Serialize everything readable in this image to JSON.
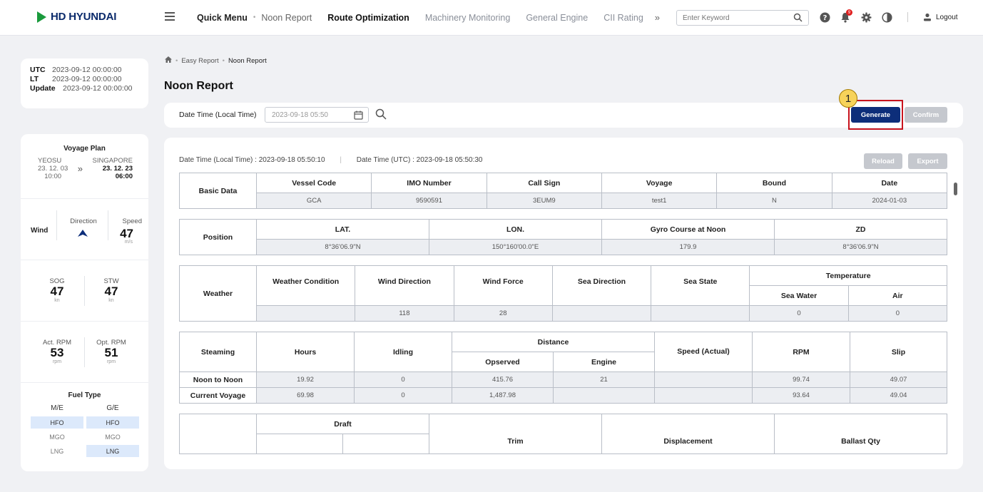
{
  "brand": {
    "name": "HD HYUNDAI"
  },
  "nav": {
    "quick_menu": "Quick Menu",
    "noon_report": "Noon Report",
    "items": [
      "Route Optimization",
      "Machinery Monitoring",
      "General Engine",
      "CII Rating"
    ],
    "more": "»"
  },
  "search": {
    "placeholder": "Enter Keyword"
  },
  "header": {
    "notification_count": "9",
    "logout": "Logout"
  },
  "time": {
    "utc_label": "UTC",
    "utc": "2023-09-12 00:00:00",
    "lt_label": "LT",
    "lt": "2023-09-12 00:00:00",
    "update_label": "Update",
    "update": "2023-09-12 00:00:00"
  },
  "voyage": {
    "title": "Voyage Plan",
    "from": "YEOSU",
    "to": "SINGAPORE",
    "from_date": "23. 12. 03",
    "from_time": "10:00",
    "to_date": "23. 12. 23",
    "to_time": "06:00",
    "arrow": "»"
  },
  "wind": {
    "label": "Wind",
    "direction_label": "Direction",
    "speed_label": "Speed",
    "speed": "47",
    "speed_unit": "m/s"
  },
  "speed": {
    "sog_label": "SOG",
    "sog": "47",
    "sog_unit": "kn",
    "stw_label": "STW",
    "stw": "47",
    "stw_unit": "kn"
  },
  "rpm": {
    "act_label": "Act. RPM",
    "act": "53",
    "act_unit": "rpm",
    "opt_label": "Opt. RPM",
    "opt": "51",
    "opt_unit": "rpm"
  },
  "fuel": {
    "title": "Fuel Type",
    "me": "M/E",
    "ge": "G/E",
    "me_items": [
      "HFO",
      "MGO",
      "LNG"
    ],
    "ge_items": [
      "HFO",
      "MGO",
      "LNG"
    ]
  },
  "breadcrumb": {
    "items": [
      "Easy Report",
      "Noon Report"
    ]
  },
  "page": {
    "title": "Noon Report"
  },
  "filter": {
    "label": "Date Time (Local Time)",
    "date": "2023-09-18 05:50"
  },
  "buttons": {
    "generate": "Generate",
    "confirm": "Confirm",
    "reload": "Reload",
    "export": "Export"
  },
  "annotation": {
    "number": "1"
  },
  "report": {
    "local_label": "Date Time (Local Time) :",
    "local": "2023-09-18 05:50:10",
    "utc_label": "Date Time (UTC)  :",
    "utc": "2023-09-18  05:50:30",
    "basic": {
      "row": "Basic Data",
      "headers": [
        "Vessel Code",
        "IMO Number",
        "Call Sign",
        "Voyage",
        "Bound",
        "Date"
      ],
      "values": [
        "GCA",
        "9590591",
        "3EUM9",
        "test1",
        "N",
        "2024-01-03"
      ]
    },
    "position": {
      "row": "Position",
      "headers": [
        "LAT.",
        "LON.",
        "Gyro Course at Noon",
        "ZD"
      ],
      "values": [
        "8°36'06.9\"N",
        "150°160'00.0\"E",
        "179.9",
        "8°36'06.9\"N"
      ]
    },
    "weather": {
      "row": "Weather",
      "headers": [
        "Weather Condition",
        "Wind Direction",
        "Wind Force",
        "Sea Direction",
        "Sea State"
      ],
      "temp": "Temperature",
      "temp_sub": [
        "Sea Water",
        "Air"
      ],
      "values": [
        "",
        "118",
        "28",
        "",
        "",
        "0",
        "0"
      ]
    },
    "steaming": {
      "row": "Steaming",
      "hours": "Hours",
      "idling": "Idling",
      "distance": "Distance",
      "dist_sub": [
        "Opserved",
        "Engine"
      ],
      "speed": "Speed (Actual)",
      "rpm": "RPM",
      "slip": "Slip",
      "rows": [
        {
          "label": "Noon to Noon",
          "values": [
            "19.92",
            "0",
            "415.76",
            "21",
            "",
            "99.74",
            "49.07"
          ]
        },
        {
          "label": "Current Voyage",
          "values": [
            "69.98",
            "0",
            "1,487.98",
            "",
            "",
            "93.64",
            "49.04"
          ]
        }
      ]
    },
    "draft": {
      "draft": "Draft",
      "trim": "Trim",
      "displacement": "Displacement",
      "ballast": "Ballast Qty"
    }
  }
}
